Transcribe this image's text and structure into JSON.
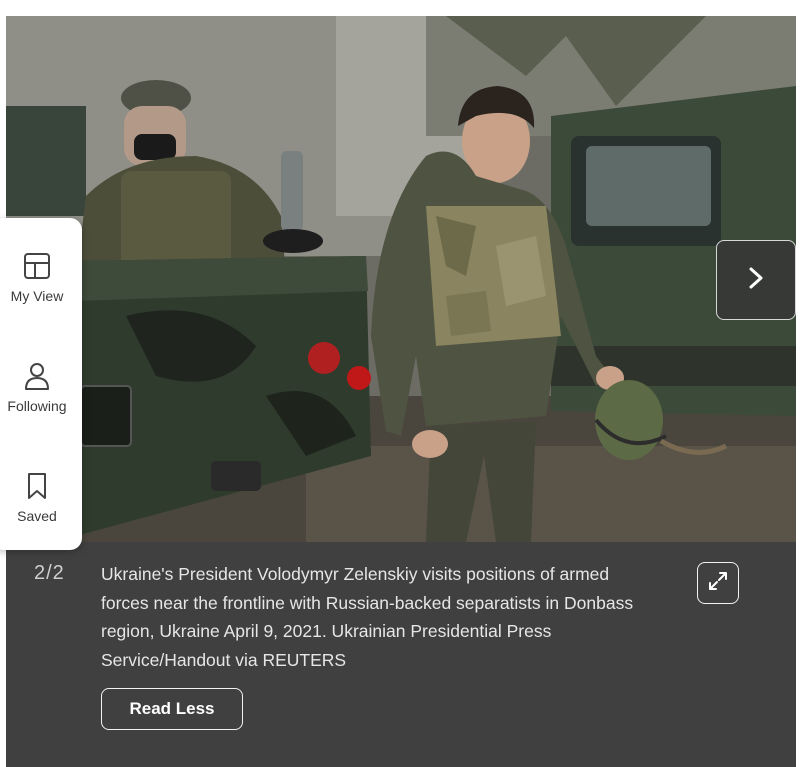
{
  "side_nav": {
    "items": [
      {
        "label": "My View",
        "icon": "layout-icon"
      },
      {
        "label": "Following",
        "icon": "person-icon"
      },
      {
        "label": "Saved",
        "icon": "bookmark-icon"
      }
    ]
  },
  "gallery": {
    "counter": "2/2",
    "caption": "Ukraine's President Volodymyr Zelenskiy visits positions of armed forces near the frontline with Russian-backed separatists in Donbass region, Ukraine April 9, 2021. Ukrainian Presidential Press Service/Handout via REUTERS",
    "read_less_label": "Read Less",
    "next_icon": "chevron-right-icon",
    "expand_icon": "expand-icon"
  },
  "colors": {
    "caption_bg": "#404040",
    "caption_text": "#e6e6e6",
    "side_panel_bg": "#ffffff"
  }
}
